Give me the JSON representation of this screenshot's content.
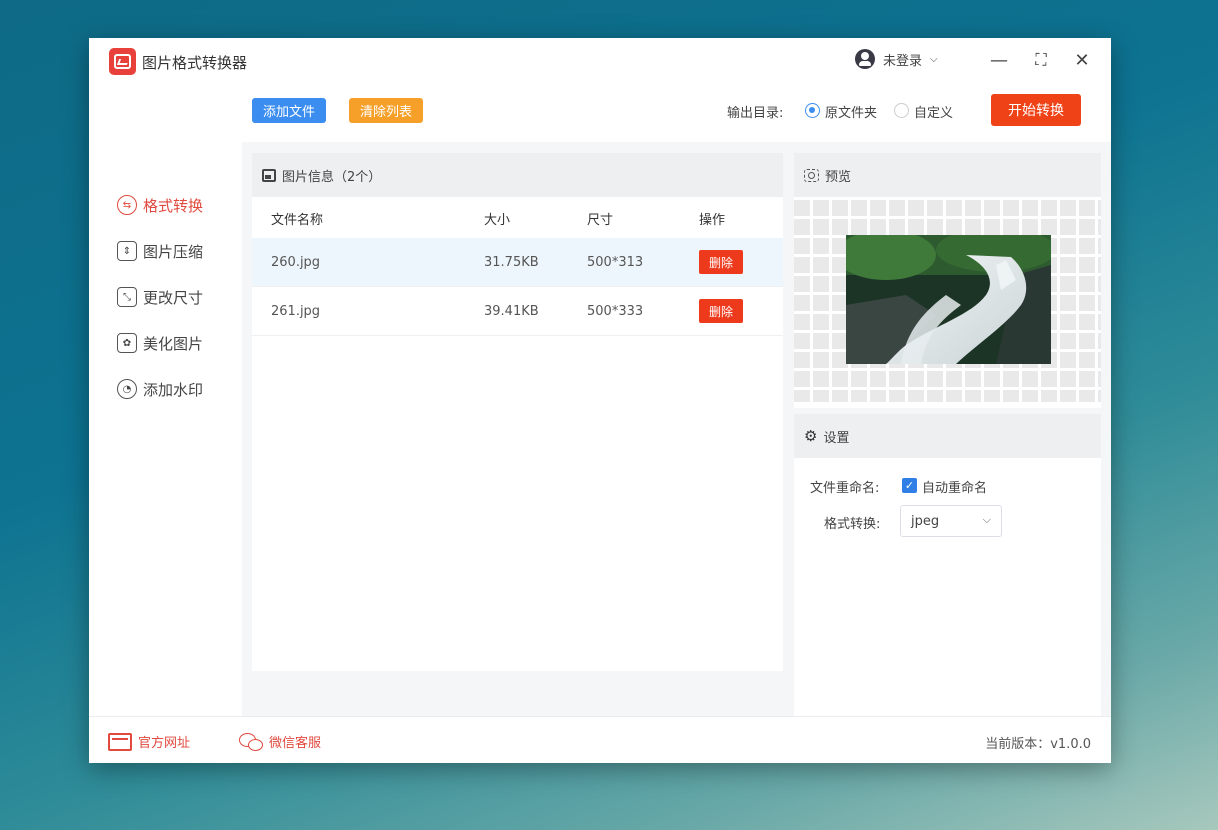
{
  "app": {
    "title": "图片格式转换器",
    "user_label": "未登录"
  },
  "window_controls": {
    "minimize": "—",
    "maximize": "⛶",
    "close": "✕"
  },
  "sidebar": {
    "items": [
      {
        "label": "格式转换",
        "icon": "format-convert-icon",
        "active": true
      },
      {
        "label": "图片压缩",
        "icon": "compress-icon",
        "active": false
      },
      {
        "label": "更改尺寸",
        "icon": "resize-icon",
        "active": false
      },
      {
        "label": "美化图片",
        "icon": "beautify-icon",
        "active": false
      },
      {
        "label": "添加水印",
        "icon": "watermark-icon",
        "active": false
      }
    ]
  },
  "toolbar": {
    "add_label": "添加文件",
    "clear_label": "清除列表",
    "output_label": "输出目录:",
    "output_options": [
      {
        "label": "原文件夹",
        "selected": true
      },
      {
        "label": "自定义",
        "selected": false
      }
    ],
    "start_label": "开始转换"
  },
  "file_panel": {
    "title": "图片信息（2个）",
    "columns": [
      "文件名称",
      "大小",
      "尺寸",
      "操作"
    ],
    "rows": [
      {
        "name": "260.jpg",
        "size": "31.75KB",
        "dims": "500*313",
        "action": "删除",
        "selected": true
      },
      {
        "name": "261.jpg",
        "size": "39.41KB",
        "dims": "500*333",
        "action": "删除",
        "selected": false
      }
    ]
  },
  "preview": {
    "title": "预览"
  },
  "settings": {
    "title": "设置",
    "rename_label": "文件重命名:",
    "rename_checkbox_label": "自动重命名",
    "rename_checked": true,
    "format_label": "格式转换:",
    "format_value": "jpeg"
  },
  "footer": {
    "website_label": "官方网址",
    "wechat_label": "微信客服",
    "version_text": "当前版本：v1.0.0"
  },
  "colors": {
    "accent_red": "#ef4216",
    "blue": "#3b8ef0",
    "orange": "#f6a02a"
  }
}
